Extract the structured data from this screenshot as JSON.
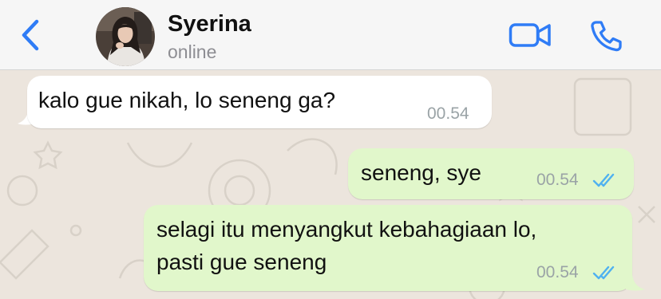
{
  "header": {
    "contact_name": "Syerina",
    "status": "online",
    "icons": {
      "back": "chevron-left-icon",
      "video": "video-camera-icon",
      "call": "phone-icon"
    },
    "accent_color": "#2f7cf6"
  },
  "messages": [
    {
      "direction": "incoming",
      "text": "kalo gue nikah, lo seneng ga?",
      "time": "00.54"
    },
    {
      "direction": "outgoing",
      "text": "seneng, sye",
      "time": "00.54",
      "status": "read"
    },
    {
      "direction": "outgoing",
      "lines": [
        "selagi itu menyangkut kebahagiaan lo,",
        "pasti gue seneng"
      ],
      "time": "00.54",
      "status": "read"
    }
  ],
  "colors": {
    "incoming_bubble": "#ffffff",
    "outgoing_bubble": "#e1f7cb",
    "read_ticks": "#4fb1f0"
  }
}
